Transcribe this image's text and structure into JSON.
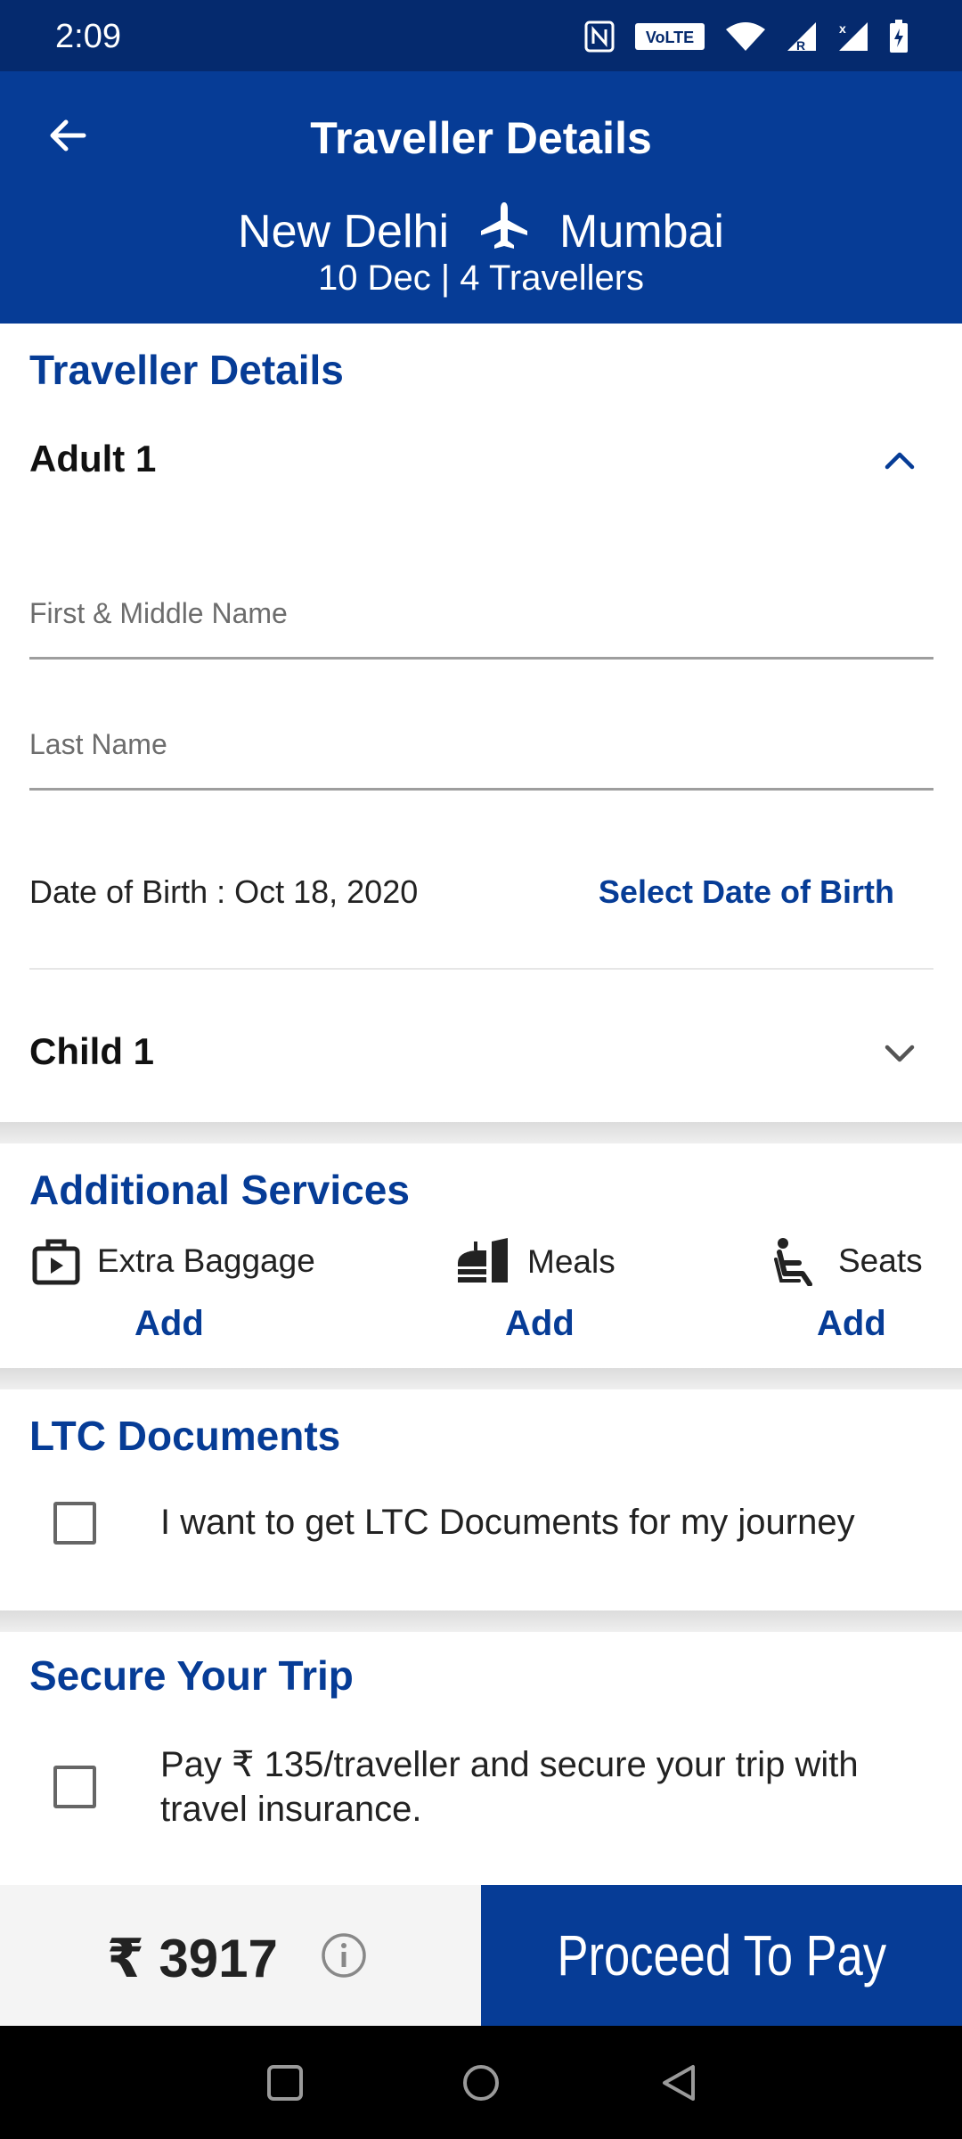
{
  "status_bar": {
    "time": "2:09",
    "volte": "VoLTE"
  },
  "header": {
    "title": "Traveller Details",
    "from": "New Delhi",
    "to": "Mumbai",
    "subtitle": "10 Dec | 4 Travellers"
  },
  "traveller_details": {
    "section_title": "Traveller Details",
    "adult": {
      "label": "Adult 1",
      "first_name_placeholder": "First & Middle Name",
      "first_name_value": "",
      "last_name_placeholder": "Last Name",
      "last_name_value": "",
      "dob_text": "Date of Birth : Oct 18, 2020",
      "dob_link": "Select Date of Birth"
    },
    "child": {
      "label": "Child 1"
    }
  },
  "additional_services": {
    "section_title": "Additional Services",
    "items": [
      {
        "label": "Extra Baggage",
        "action": "Add",
        "icon": "baggage-icon"
      },
      {
        "label": "Meals",
        "action": "Add",
        "icon": "meals-icon"
      },
      {
        "label": "Seats",
        "action": "Add",
        "icon": "seat-icon"
      }
    ]
  },
  "ltc": {
    "section_title": "LTC Documents",
    "checkbox_label": "I want to get LTC Documents for my journey",
    "checked": false
  },
  "secure_trip": {
    "section_title": "Secure Your Trip",
    "line1": "Pay ₹ 135/traveller and secure your trip with",
    "line2": "travel insurance.",
    "checked": false
  },
  "pay_bar": {
    "price": "₹ 3917",
    "button_label": "Proceed To Pay"
  },
  "colors": {
    "primary": "#063c96",
    "status_bar": "#052a6e"
  }
}
